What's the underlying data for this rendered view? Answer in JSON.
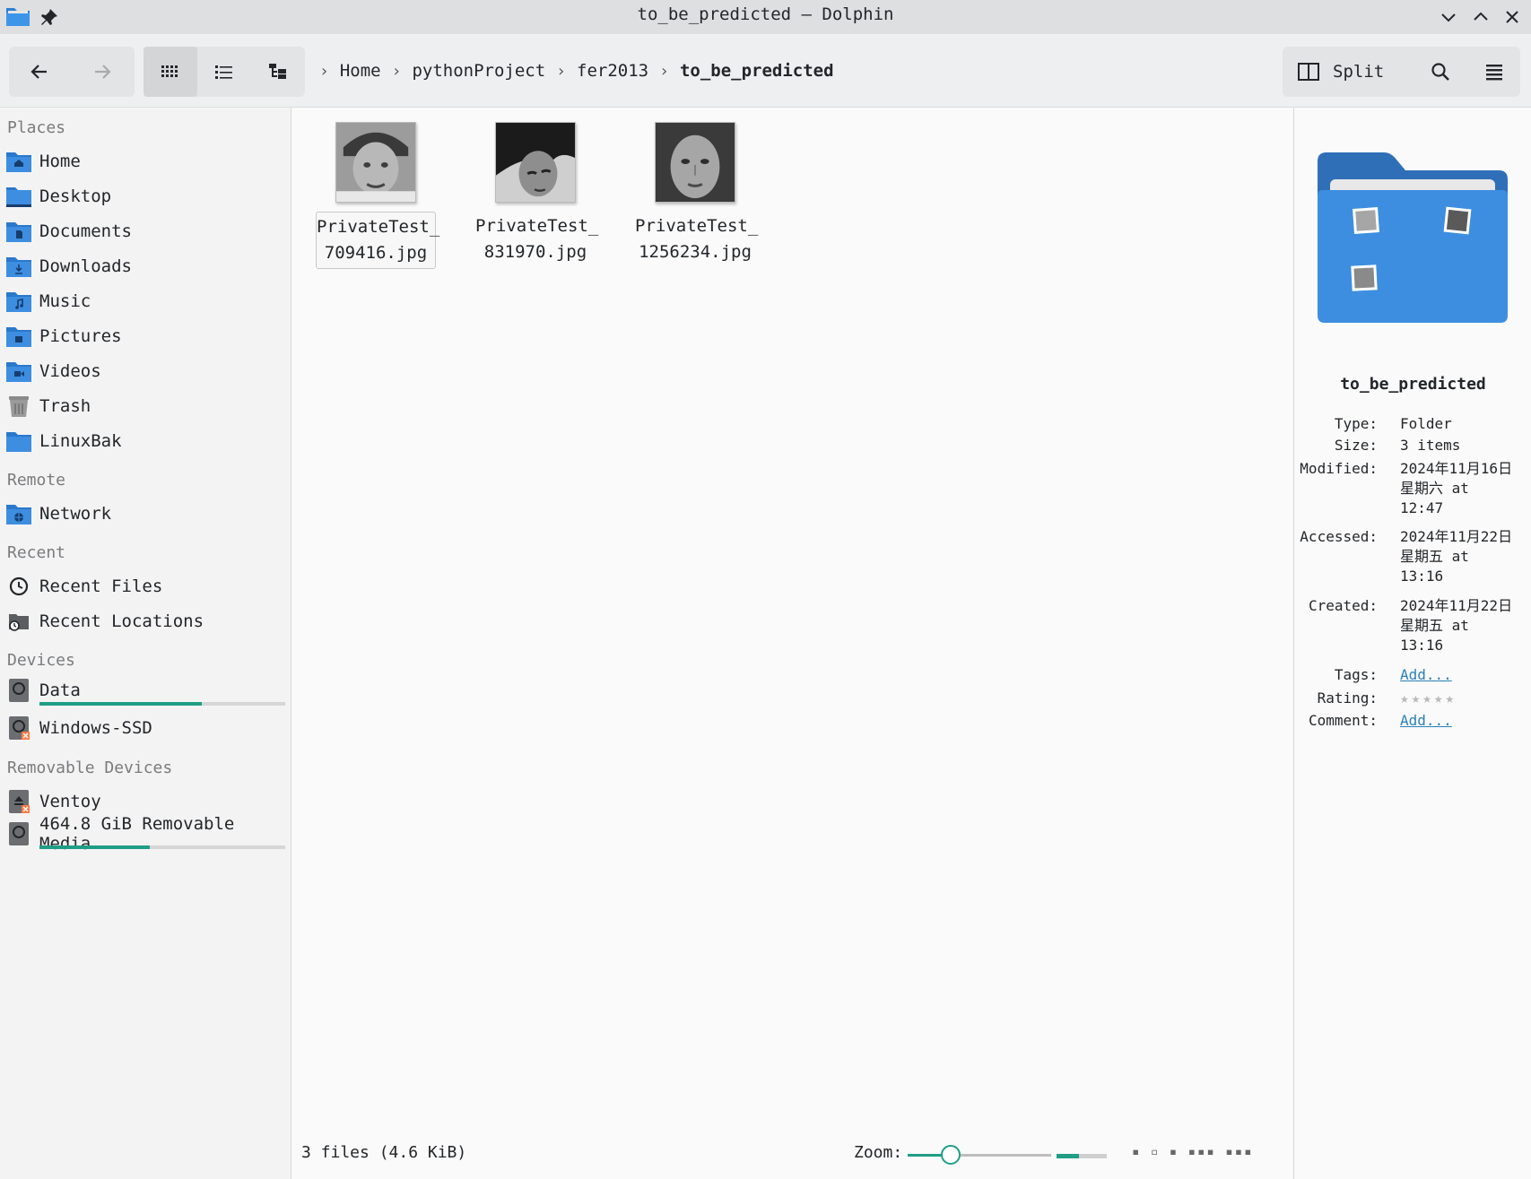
{
  "window": {
    "title": "to_be_predicted — Dolphin"
  },
  "breadcrumb": [
    "Home",
    "pythonProject",
    "fer2013",
    "to_be_predicted"
  ],
  "toolbar": {
    "split_label": "Split"
  },
  "sidebar": {
    "places_header": "Places",
    "places": [
      {
        "label": "Home",
        "icon": "folder-home-icon"
      },
      {
        "label": "Desktop",
        "icon": "folder-desktop-icon"
      },
      {
        "label": "Documents",
        "icon": "folder-documents-icon"
      },
      {
        "label": "Downloads",
        "icon": "folder-downloads-icon"
      },
      {
        "label": "Music",
        "icon": "folder-music-icon"
      },
      {
        "label": "Pictures",
        "icon": "folder-pictures-icon"
      },
      {
        "label": "Videos",
        "icon": "folder-videos-icon"
      },
      {
        "label": "Trash",
        "icon": "trash-icon"
      },
      {
        "label": "LinuxBak",
        "icon": "folder-icon"
      }
    ],
    "remote_header": "Remote",
    "remote": [
      {
        "label": "Network",
        "icon": "folder-network-icon"
      }
    ],
    "recent_header": "Recent",
    "recent": [
      {
        "label": "Recent Files",
        "icon": "clock-icon"
      },
      {
        "label": "Recent Locations",
        "icon": "recent-locations-icon"
      }
    ],
    "devices_header": "Devices",
    "devices": [
      {
        "label": "Data",
        "icon": "drive-icon",
        "usage": 0.66
      },
      {
        "label": "Windows-SSD",
        "icon": "drive-unmounted-icon"
      }
    ],
    "removable_header": "Removable Devices",
    "removable": [
      {
        "label": "Ventoy",
        "icon": "removable-drive-icon"
      },
      {
        "label": "464.8 GiB Removable Media",
        "icon": "drive-icon",
        "usage": 0.45
      }
    ]
  },
  "files": [
    {
      "name_line1": "PrivateTest_",
      "name_line2": "709416.jpg",
      "selected": true
    },
    {
      "name_line1": "PrivateTest_",
      "name_line2": "831970.jpg",
      "selected": false
    },
    {
      "name_line1": "PrivateTest_",
      "name_line2": "1256234.jpg",
      "selected": false
    }
  ],
  "statusbar": {
    "summary": "3 files (4.6 KiB)",
    "zoom_label": "Zoom:",
    "zoom_level": 0.3,
    "free_space_fraction": 0.45
  },
  "info": {
    "title": "to_be_predicted",
    "type_key": "Type:",
    "type": "Folder",
    "size_key": "Size:",
    "size": "3 items",
    "modified_key": "Modified:",
    "modified": [
      "2024年11月16日",
      "星期六 at",
      "12:47"
    ],
    "accessed_key": "Accessed:",
    "accessed": [
      "2024年11月22日",
      "星期五 at",
      "13:16"
    ],
    "created_key": "Created:",
    "created": [
      "2024年11月22日",
      "星期五 at",
      "13:16"
    ],
    "tags_key": "Tags:",
    "tags_link": "Add...",
    "rating_key": "Rating:",
    "rating": 0,
    "comment_key": "Comment:",
    "comment_link": "Add..."
  },
  "colors": {
    "accent": "#1f9e86",
    "folder_blue": "#3d8ee0",
    "link": "#2980b9"
  }
}
